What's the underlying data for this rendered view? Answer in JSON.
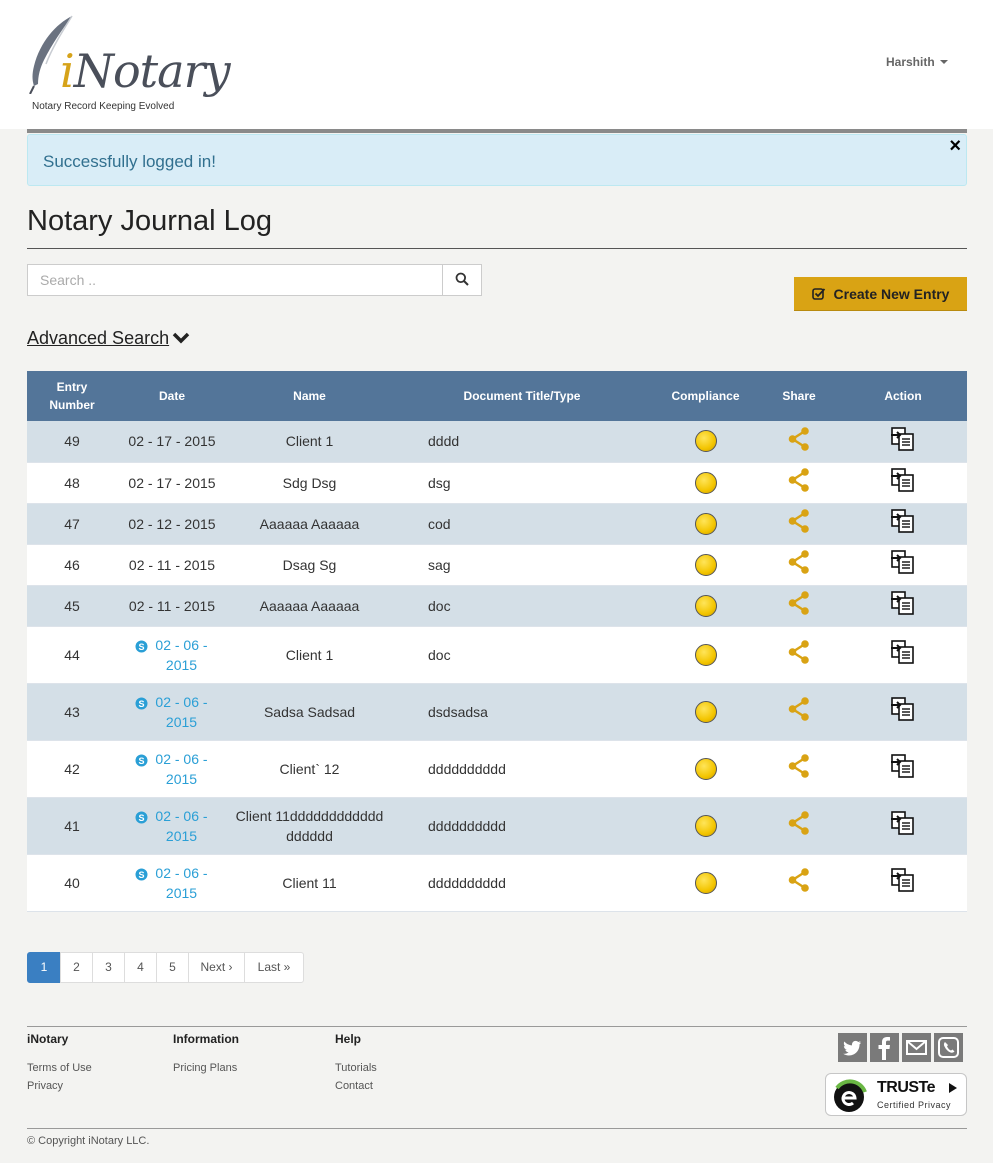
{
  "header": {
    "logo_word_i": "i",
    "logo_word_rest": "Notary",
    "logo_tagline": "Notary Record Keeping Evolved",
    "user_name": "Harshith"
  },
  "alert": {
    "message": "Successfully logged in!",
    "close_symbol": "×"
  },
  "page_title": "Notary Journal Log",
  "search": {
    "placeholder": "Search ..",
    "value": ""
  },
  "create_button_label": "Create New Entry",
  "advanced_search_label": "Advanced Search",
  "table": {
    "headers": [
      "Entry Number",
      "Date",
      "Name",
      "Document Title/Type",
      "Compliance",
      "Share",
      "Action"
    ],
    "rows": [
      {
        "entry": "49",
        "date": "02 - 17 - 2015",
        "skype": false,
        "name": "Client 1",
        "doc": "dddd"
      },
      {
        "entry": "48",
        "date": "02 - 17 - 2015",
        "skype": false,
        "name": "Sdg Dsg",
        "doc": "dsg"
      },
      {
        "entry": "47",
        "date": "02 - 12 - 2015",
        "skype": false,
        "name": "Aaaaaa Aaaaaa",
        "doc": "cod"
      },
      {
        "entry": "46",
        "date": "02 - 11 - 2015",
        "skype": false,
        "name": "Dsag Sg",
        "doc": "sag"
      },
      {
        "entry": "45",
        "date": "02 - 11 - 2015",
        "skype": false,
        "name": "Aaaaaa Aaaaaa",
        "doc": "doc"
      },
      {
        "entry": "44",
        "date": "02 - 06 - 2015",
        "skype": true,
        "name": "Client 1",
        "doc": "doc"
      },
      {
        "entry": "43",
        "date": "02 - 06 - 2015",
        "skype": true,
        "name": "Sadsa Sadsad",
        "doc": "dsdsadsa"
      },
      {
        "entry": "42",
        "date": "02 - 06 - 2015",
        "skype": true,
        "name": "Client` 12",
        "doc": "dddddddddd"
      },
      {
        "entry": "41",
        "date": "02 - 06 - 2015",
        "skype": true,
        "name": "Client 11dddddddddddddddddd",
        "doc": "dddddddddd"
      },
      {
        "entry": "40",
        "date": "02 - 06 - 2015",
        "skype": true,
        "name": "Client 11",
        "doc": "dddddddddd"
      }
    ]
  },
  "pagination": {
    "pages": [
      "1",
      "2",
      "3",
      "4",
      "5"
    ],
    "active_page": "1",
    "next_label": "Next ›",
    "last_label": "Last »"
  },
  "footer": {
    "col1_title": "iNotary",
    "col1_links": [
      "Terms of Use",
      "Privacy"
    ],
    "col2_title": "Information",
    "col2_links": [
      "Pricing Plans"
    ],
    "col3_title": "Help",
    "col3_links": [
      "Tutorials",
      "Contact"
    ],
    "social_icons": [
      "twitter-icon",
      "facebook-icon",
      "mail-icon",
      "phone-icon"
    ],
    "truste_title": "TRUSTe",
    "truste_subtitle": "Certified Privacy",
    "copyright": "© Copyright iNotary LLC."
  },
  "colors": {
    "table_header": "#537599",
    "row_stripe": "#d4dfe7",
    "accent_gold": "#d9a314",
    "alert_bg": "#d9edf7",
    "link_blue": "#2a9fd6",
    "pagination_active": "#3a7fc2"
  }
}
